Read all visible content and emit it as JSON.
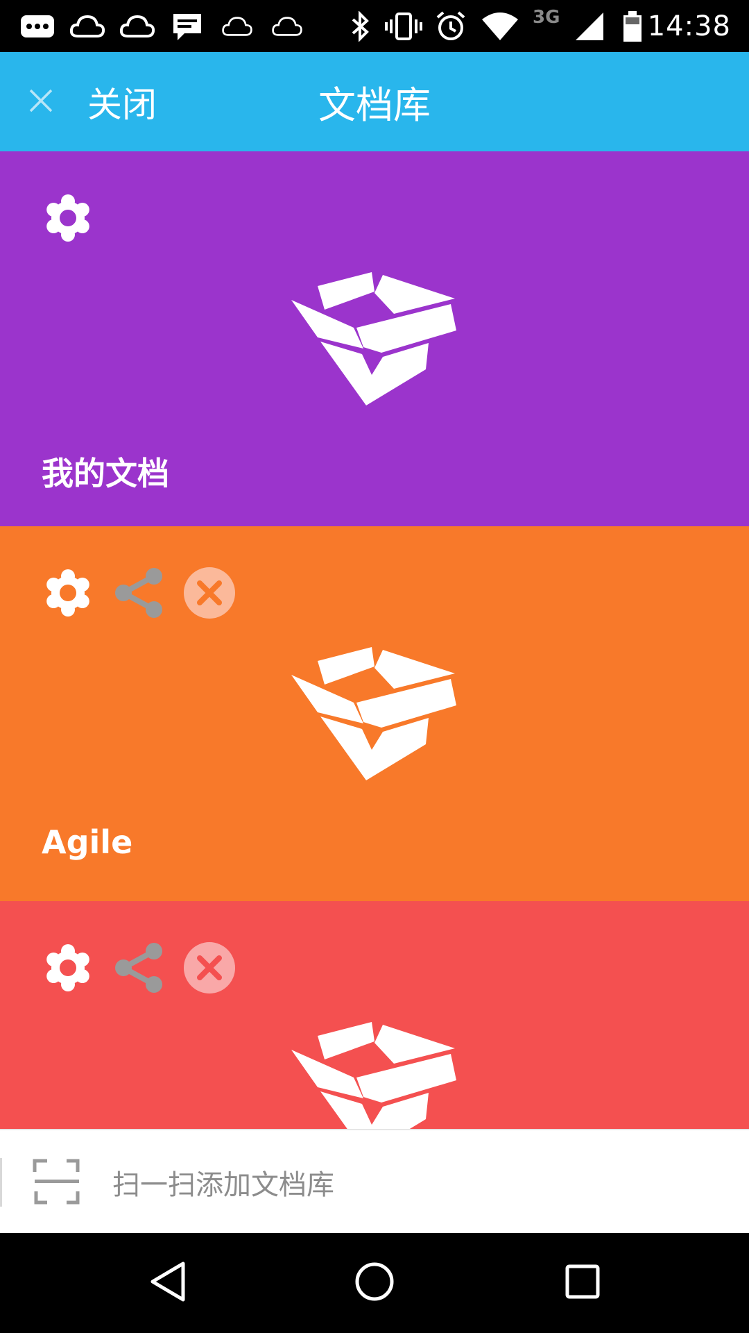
{
  "status_bar": {
    "time": "14:38",
    "network_type": "3G",
    "icons": [
      "more-icon",
      "cloud-icon",
      "cloud-icon",
      "message-icon",
      "cloud-outline-icon",
      "cloud-outline-icon",
      "bluetooth-icon",
      "vibrate-icon",
      "alarm-icon",
      "wifi-icon",
      "signal-icon",
      "battery-icon"
    ]
  },
  "header": {
    "close_label": "关闭",
    "title": "文档库",
    "background": "#29b6ec"
  },
  "libraries": [
    {
      "name": "我的文档",
      "color": "#9b34cc",
      "has_share": false,
      "has_delete": false
    },
    {
      "name": "Agile",
      "color": "#f8792a",
      "has_share": true,
      "has_delete": true
    },
    {
      "name": "",
      "color": "#f45050",
      "has_share": true,
      "has_delete": true
    }
  ],
  "scan_bar": {
    "label": "扫一扫添加文档库"
  },
  "nav": {
    "icons": [
      "back-icon",
      "home-icon",
      "recents-icon"
    ]
  }
}
